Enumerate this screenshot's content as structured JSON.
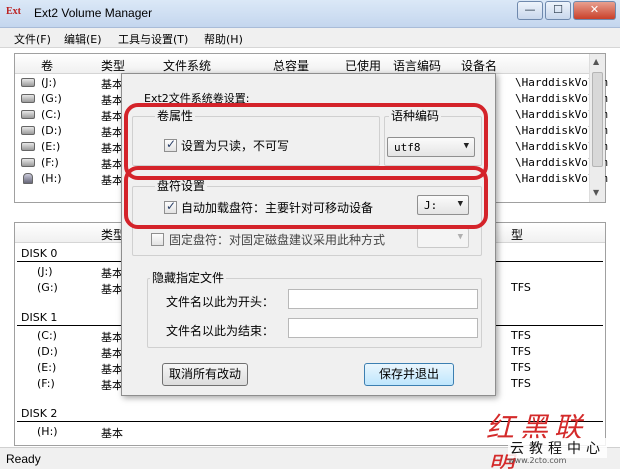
{
  "window": {
    "icon_text": "Ext",
    "title": "Ext2 Volume Manager",
    "minimize": "—",
    "maximize": "☐",
    "close": "✕"
  },
  "menu": [
    "文件(F)",
    "编辑(E)",
    "工具与设置(T)",
    "帮助(H)"
  ],
  "volume_list": {
    "columns": [
      "卷",
      "类型",
      "文件系统",
      "总容量",
      "已使用",
      "语言编码",
      "设备名"
    ],
    "rows": [
      {
        "vol": "(J:)",
        "type": "基本",
        "device": "\\HarddiskVolum"
      },
      {
        "vol": "(G:)",
        "type": "基本",
        "device": "\\HarddiskVolum"
      },
      {
        "vol": "(C:)",
        "type": "基本",
        "device": "\\HarddiskVolum"
      },
      {
        "vol": "(D:)",
        "type": "基本",
        "device": "\\HarddiskVolum"
      },
      {
        "vol": "(E:)",
        "type": "基本",
        "device": "\\HarddiskVolum"
      },
      {
        "vol": "(F:)",
        "type": "基本",
        "device": "\\HarddiskVolum"
      },
      {
        "vol": "(H:)",
        "type": "基本",
        "device": "\\HarddiskVolum"
      }
    ]
  },
  "disk_list": {
    "columns": [
      "类型",
      "型"
    ],
    "disks": [
      {
        "name": "DISK 0",
        "vols": [
          {
            "vol": "(J:)",
            "type": "基本",
            "fs": ""
          },
          {
            "vol": "(G:)",
            "type": "基本",
            "fs": "TFS"
          }
        ]
      },
      {
        "name": "DISK 1",
        "vols": [
          {
            "vol": "(C:)",
            "type": "基本",
            "fs": "TFS"
          },
          {
            "vol": "(D:)",
            "type": "基本",
            "fs": "TFS"
          },
          {
            "vol": "(E:)",
            "type": "基本",
            "fs": "TFS"
          },
          {
            "vol": "(F:)",
            "type": "基本",
            "fs": "TFS"
          }
        ]
      },
      {
        "name": "DISK 2",
        "vols": [
          {
            "vol": "(H:)",
            "type": "基本",
            "fs": ""
          }
        ]
      }
    ]
  },
  "status": "Ready",
  "dialog": {
    "title": "Ext2文件系统卷设置:",
    "volume_props": {
      "title": "卷属性",
      "readonly_label": "设置为只读，不可写",
      "readonly_checked": true
    },
    "encoding": {
      "title": "语种编码",
      "value": "utf8"
    },
    "drive_letter": {
      "title": "盘符设置",
      "auto_label": "自动加载盘符：主要针对可移动设备",
      "auto_checked": true,
      "auto_value": "J:",
      "fixed_label": "固定盘符：对固定磁盘建议采用此种方式",
      "fixed_checked": false,
      "fixed_value": ""
    },
    "hidden_files": {
      "title": "隐藏指定文件",
      "prefix_label": "文件名以此为开头：",
      "prefix_value": "",
      "suffix_label": "文件名以此为结束：",
      "suffix_value": ""
    },
    "cancel_button": "取消所有改动",
    "save_button": "保存并退出"
  },
  "watermark": {
    "mark": "红黑联盟",
    "text": "云教程中心",
    "url": "www.2cto.com"
  },
  "colors": {
    "highlight": "#d4232a",
    "titlebar": "#c4d6ee"
  }
}
